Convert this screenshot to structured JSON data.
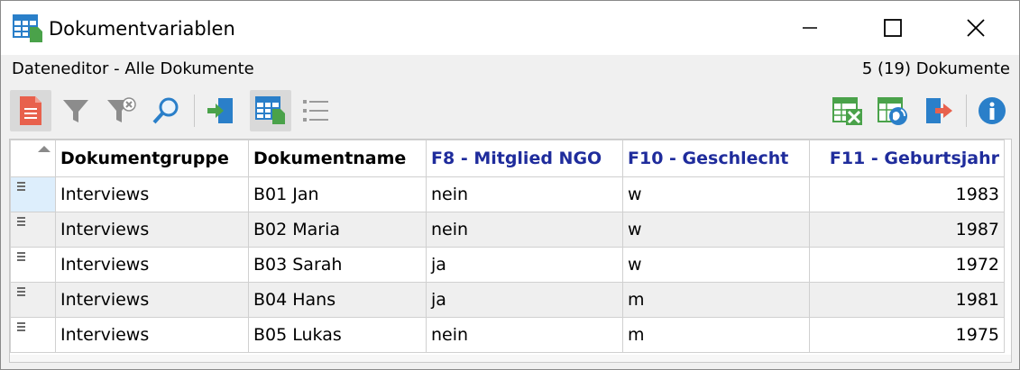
{
  "window": {
    "title": "Dokumentvariablen",
    "minimize_icon": "minimize-icon",
    "maximize_icon": "maximize-icon",
    "close_icon": "close-icon"
  },
  "subheader": {
    "left": "Dateneditor - Alle Dokumente",
    "right": "5 (19) Dokumente"
  },
  "toolbar": {
    "left_icons": [
      "document-icon",
      "filter-icon",
      "clear-filter-icon",
      "search-icon",
      "import-icon",
      "table-view-icon",
      "list-view-icon"
    ],
    "right_icons": [
      "excel-export-icon",
      "web-export-icon",
      "export-icon",
      "info-icon"
    ],
    "colors": {
      "red": "#e8614d",
      "gray": "#8c8c8c",
      "green": "#4aa24a",
      "blue": "#2a7fc9",
      "active_bg": "#d9d9d9"
    }
  },
  "table": {
    "columns": [
      {
        "label": "Dokumentgruppe",
        "is_variable": false
      },
      {
        "label": "Dokumentname",
        "is_variable": false
      },
      {
        "label": "F8 - Mitglied NGO",
        "is_variable": true
      },
      {
        "label": "F10 - Geschlecht",
        "is_variable": true
      },
      {
        "label": "F11 - Geburtsjahr",
        "is_variable": true
      }
    ],
    "variable_header_color": "#1f2c9c",
    "rows": [
      [
        "Interviews",
        "B01 Jan",
        "nein",
        "w",
        "1983"
      ],
      [
        "Interviews",
        "B02 Maria",
        "nein",
        "w",
        "1987"
      ],
      [
        "Interviews",
        "B03 Sarah",
        "ja",
        "w",
        "1972"
      ],
      [
        "Interviews",
        "B04 Hans",
        "ja",
        "m",
        "1981"
      ],
      [
        "Interviews",
        "B05 Lukas",
        "nein",
        "m",
        "1975"
      ]
    ]
  }
}
